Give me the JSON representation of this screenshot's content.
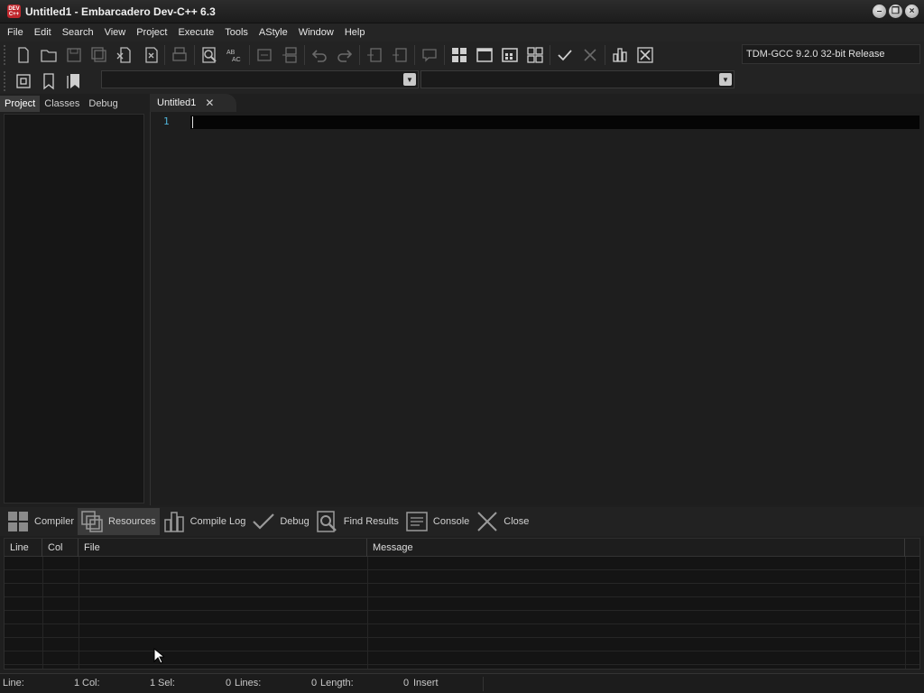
{
  "window": {
    "title": "Untitled1 - Embarcadero Dev-C++ 6.3",
    "app_icon_text": "DEV C++"
  },
  "menu": [
    "File",
    "Edit",
    "Search",
    "View",
    "Project",
    "Execute",
    "Tools",
    "AStyle",
    "Window",
    "Help"
  ],
  "toolbar": {
    "compiler": "TDM-GCC 9.2.0 32-bit Release",
    "icons_row1": [
      "new-file-icon",
      "open-folder-icon",
      "save-icon",
      "save-all-icon",
      "close-file-icon",
      "close-all-icon",
      "print-icon",
      "find-icon",
      "replace-icon",
      "indent-icon",
      "unindent-icon",
      "undo-icon",
      "redo-icon",
      "insert-icon",
      "remove-icon",
      "comment-icon",
      "compile-icon",
      "run-icon",
      "compile-run-icon",
      "rebuild-icon",
      "check-icon",
      "stop-icon",
      "chart-icon",
      "close-box-icon"
    ],
    "icons_row2": [
      "project-icon",
      "bookmark-icon",
      "bookmarks-icon"
    ]
  },
  "left_tabs": [
    "Project",
    "Classes",
    "Debug"
  ],
  "editor": {
    "tab_label": "Untitled1",
    "line_number": "1"
  },
  "bottom_tabs": [
    "Compiler",
    "Resources",
    "Compile Log",
    "Debug",
    "Find Results",
    "Console",
    "Close"
  ],
  "grid_columns": [
    "Line",
    "Col",
    "File",
    "Message"
  ],
  "status": {
    "line_label": "Line:",
    "line_value": "1",
    "col_label": "Col:",
    "col_value": "1",
    "sel_label": "Sel:",
    "sel_value": "0",
    "lines_label": "Lines:",
    "lines_value": "0",
    "length_label": "Length:",
    "length_value": "0",
    "mode": "Insert"
  },
  "colors": {
    "background": "#1f1f1f",
    "line_number": "#4fb3d9",
    "app_icon": "#c0272d"
  }
}
